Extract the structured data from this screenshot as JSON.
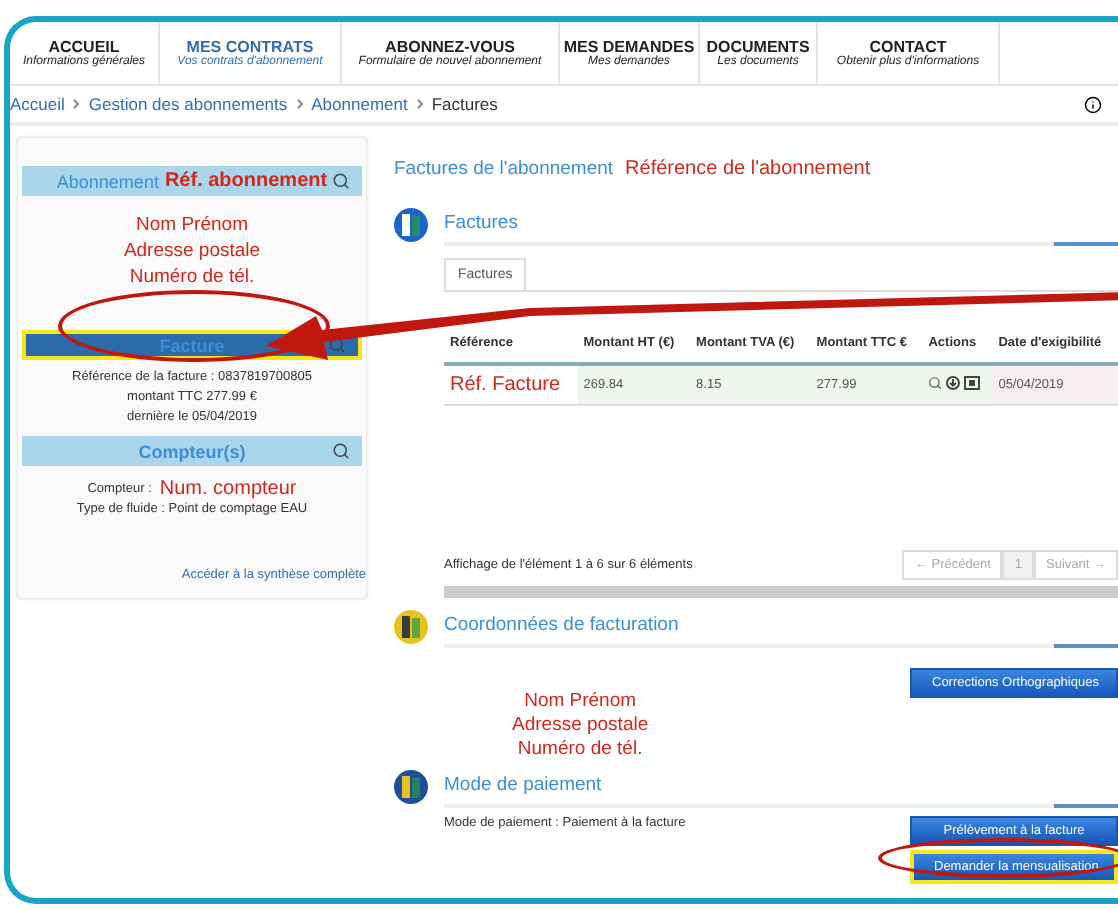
{
  "nav": [
    {
      "title": "ACCUEIL",
      "subtitle": "Informations générales",
      "selected": false
    },
    {
      "title": "MES CONTRATS",
      "subtitle": "Vos contrats d'abonnement",
      "selected": true
    },
    {
      "title": "ABONNEZ-VOUS",
      "subtitle": "Formulaire de nouvel abonnement",
      "selected": false
    },
    {
      "title": "MES DEMANDES",
      "subtitle": "Mes demandes",
      "selected": false
    },
    {
      "title": "DOCUMENTS",
      "subtitle": "Les documents",
      "selected": false
    },
    {
      "title": "CONTACT",
      "subtitle": "Obtenir plus d'informations",
      "selected": false
    }
  ],
  "breadcrumb": [
    "Accueil",
    "Gestion des abonnements",
    "Abonnement",
    "Factures"
  ],
  "sidebar": {
    "abonnement": {
      "header": "Abonnement",
      "annotation": "Réf. abonnement",
      "lines": [
        "Nom Prénom",
        "Adresse postale",
        "Numéro de tél."
      ]
    },
    "facture": {
      "header": "Facture",
      "highlighted": true,
      "lines": [
        "Référence de la facture : 0837819700805",
        "montant TTC 277.99 €",
        "dernière le 05/04/2019"
      ]
    },
    "compteur": {
      "header": "Compteur(s)",
      "label": "Compteur :",
      "value": "Num. compteur",
      "fluid": "Type de fluide : Point de comptage EAU"
    },
    "link": "Accéder à la synthèse complète"
  },
  "content": {
    "title": "Factures de l'abonnement",
    "title_annotation": "Référence de l'abonnement",
    "invoices": {
      "heading": "Factures",
      "tab": "Factures",
      "columns": [
        "Référence",
        "Montant HT (€)",
        "Montant TVA (€)",
        "Montant TTC €",
        "Actions",
        "Date d'exigibilité"
      ],
      "rows": [
        {
          "reference": "Réf. Facture",
          "ht": "269.84",
          "tva": "8.15",
          "ttc": "277.99",
          "date": "05/04/2019"
        }
      ],
      "info": "Affichage de l'élément 1 à 6 sur 6 éléments",
      "pager": [
        {
          "label": "← Précédent",
          "selected": false
        },
        {
          "label": "1",
          "selected": true
        },
        {
          "label": "Suivant →",
          "selected": false
        }
      ]
    },
    "billing": {
      "heading": "Coordonnées de facturation",
      "button": "Corrections Orthographiques",
      "lines": [
        "Nom Prénom",
        "Adresse postale",
        "Numéro de tél."
      ]
    },
    "payment": {
      "heading": "Mode de paiement",
      "text": "Mode de paiement : Paiement à la facture",
      "buttons": [
        {
          "label": "Prélèvement à la facture",
          "highlighted": false
        },
        {
          "label": "Demander la mensualisation",
          "highlighted": true
        }
      ]
    }
  }
}
